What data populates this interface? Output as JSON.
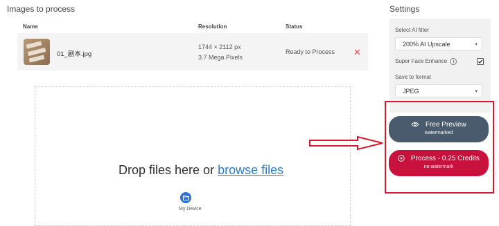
{
  "images": {
    "title": "Images to process",
    "columns": {
      "name": "Name",
      "resolution": "Resolution",
      "status": "Status"
    },
    "rows": [
      {
        "filename": "01_剧本.jpg",
        "dimensions": "1744 × 2112 px",
        "megapixels": "3.7 Mega Pixels",
        "status": "Ready to Process",
        "remove_glyph": "✕"
      }
    ]
  },
  "dropzone": {
    "prompt": "Drop files here or",
    "link": "browse files",
    "device_label": "My Device"
  },
  "settings": {
    "title": "Settings",
    "filter_label": "Select AI filter",
    "filter_value": "200% AI Upscale",
    "face_enhance_label": "Super Face Enhance",
    "face_enhance_checked": true,
    "format_label": "Save to format",
    "format_value": "JPEG",
    "caret": "▾"
  },
  "actions": {
    "preview_label": "Free Preview",
    "preview_sub": "watermarked",
    "process_label": "Process - 0.25 Credits",
    "process_sub": "no watermark",
    "preview_color": "#4a5b6e",
    "process_color": "#c8123d",
    "highlight_color": "#d7192f"
  }
}
